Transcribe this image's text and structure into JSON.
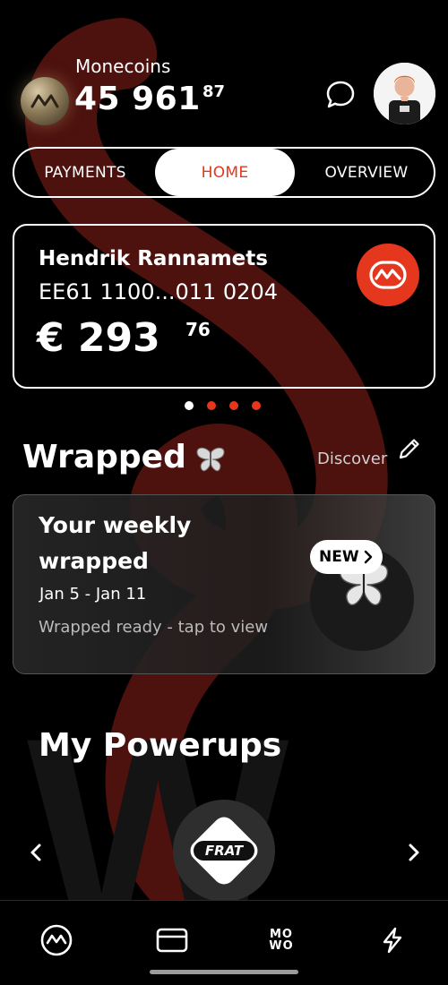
{
  "header": {
    "coins_label": "Monecoins",
    "coins_amount": "45 961",
    "coins_cents": "87"
  },
  "tabs": [
    {
      "label": "PAYMENTS",
      "active": false
    },
    {
      "label": "HOME",
      "active": true
    },
    {
      "label": "OVERVIEW",
      "active": false
    }
  ],
  "account": {
    "holder": "Hendrik Rannamets",
    "iban": "EE61 1100...011 0204",
    "balance": "€ 293",
    "balance_cents": "76"
  },
  "carousel": {
    "total": 4,
    "active_index": 0
  },
  "wrapped": {
    "title": "Wrapped",
    "discover": "Discover",
    "card_title": "Your weekly wrapped",
    "date_range": "Jan 5 - Jan 11",
    "subtitle": "Wrapped ready - tap to view",
    "badge": "NEW"
  },
  "powerups": {
    "title": "My Powerups",
    "current_label": "FRAT"
  },
  "colors": {
    "accent": "#e4371e",
    "background": "#000000",
    "text": "#ffffff"
  },
  "icons": {
    "coin": "monecoin-icon",
    "chat": "chat-bubble-icon",
    "logo": "mone-logo-icon",
    "butterfly": "butterfly-icon",
    "pencil": "pencil-icon",
    "nav": [
      "pulse-home-icon",
      "card-icon",
      "mowo-icon",
      "lightning-icon"
    ]
  },
  "bottom_nav": {
    "mowo_line1": "MO",
    "mowo_line2": "WO"
  }
}
